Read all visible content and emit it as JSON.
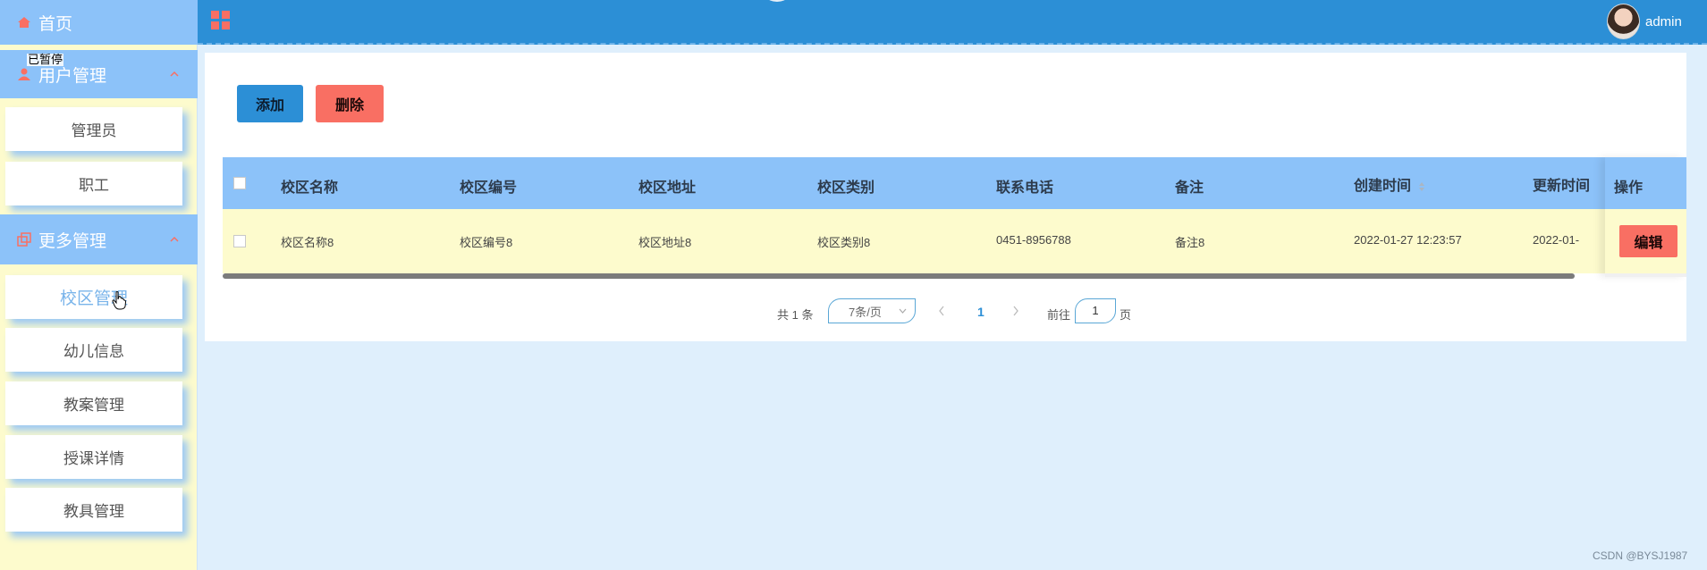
{
  "sidebar": {
    "home": "首页",
    "tooltip": "已暂停",
    "group_user": "用户管理",
    "user_items": [
      "管理员",
      "职工"
    ],
    "group_more": "更多管理",
    "more_items": [
      "校区管理",
      "幼儿信息",
      "教案管理",
      "授课详情",
      "教具管理"
    ],
    "active_item": "校区管理"
  },
  "header": {
    "username": "admin"
  },
  "toolbar": {
    "add_label": "添加",
    "delete_label": "删除"
  },
  "table": {
    "columns": [
      "校区名称",
      "校区编号",
      "校区地址",
      "校区类别",
      "联系电话",
      "备注",
      "创建时间",
      "更新时间"
    ],
    "action_column": "操作",
    "rows": [
      [
        "校区名称8",
        "校区编号8",
        "校区地址8",
        "校区类别8",
        "0451-8956788",
        "备注8",
        "2022-01-27 12:23:57",
        "2022-01-"
      ]
    ],
    "edit_label": "编辑"
  },
  "pagination": {
    "total_text": "共 1 条",
    "page_size": "7条/页",
    "current_page": "1",
    "goto_prefix": "前往",
    "goto_value": "1",
    "goto_suffix": "页"
  },
  "watermark": "CSDN @BYSJ1987",
  "colors": {
    "topbar": "#2c8fd6",
    "sidebar_head": "#8cc2f9",
    "row_bg": "#fdfbcd",
    "danger": "#f96f63"
  }
}
